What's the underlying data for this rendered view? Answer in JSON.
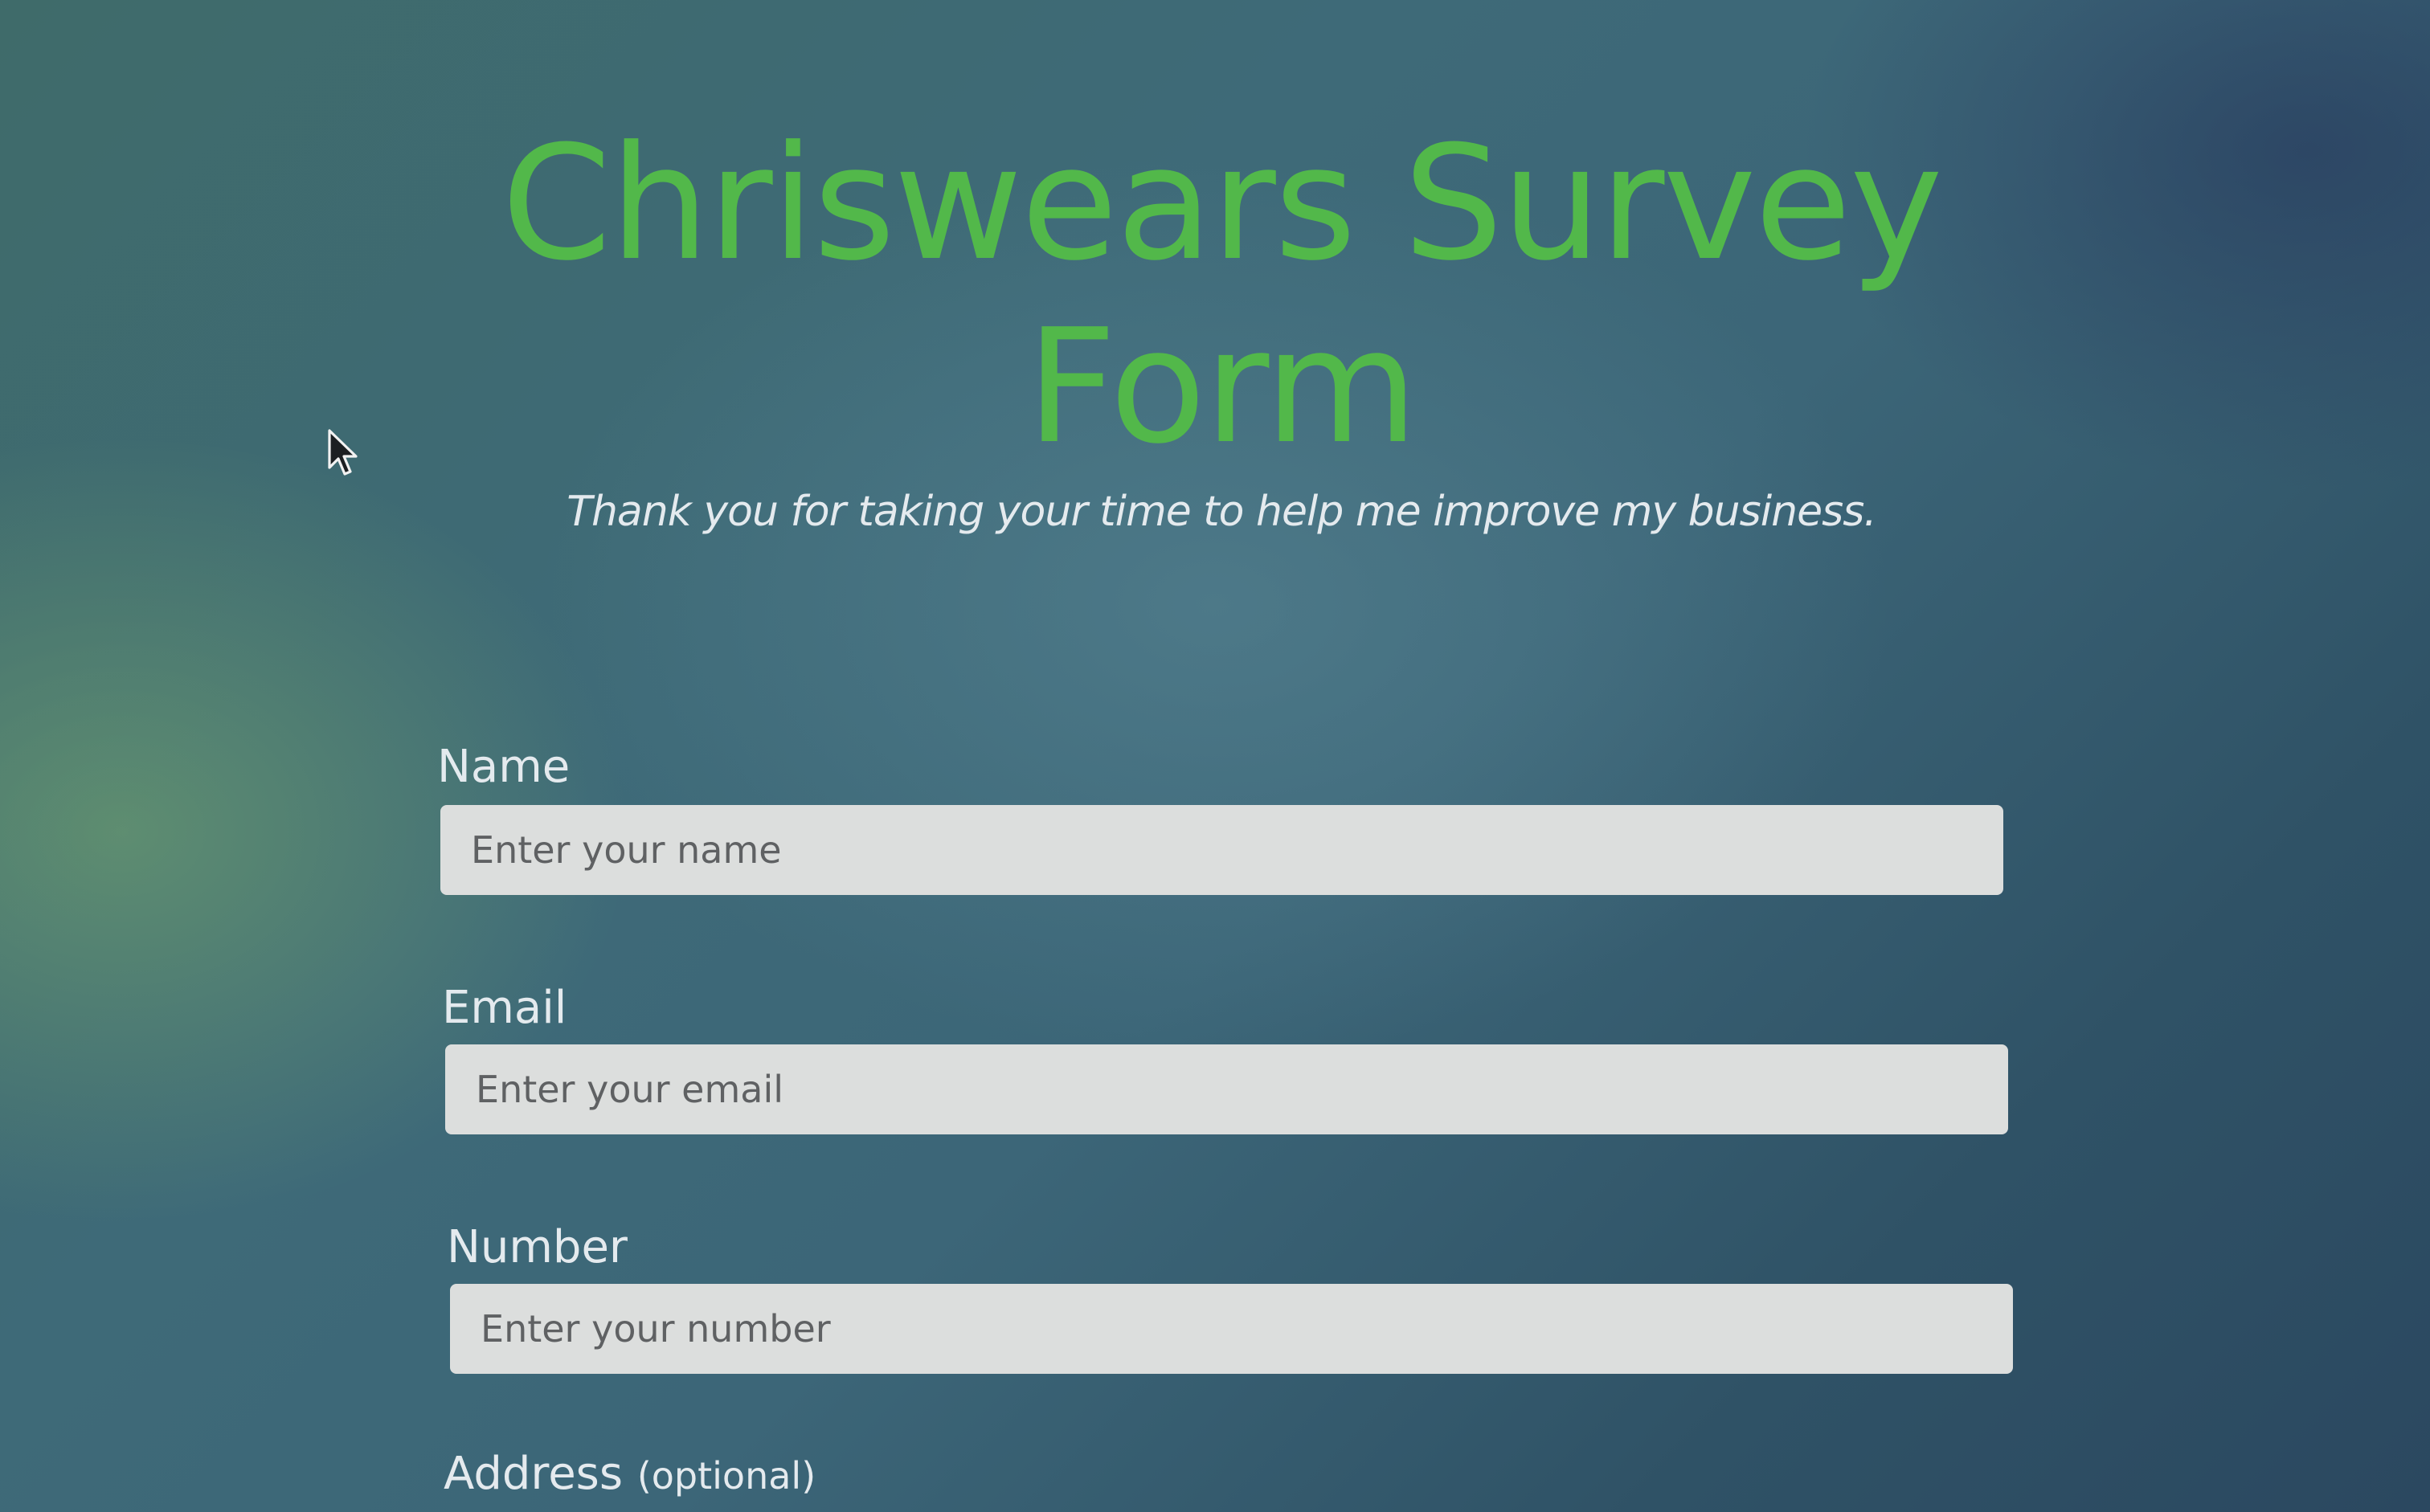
{
  "header": {
    "title": "Chriswears Survey Form",
    "description": "Thank you for taking your time to help me improve my business."
  },
  "form": {
    "name": {
      "label": "Name",
      "placeholder": "Enter your name"
    },
    "email": {
      "label": "Email",
      "placeholder": "Enter your email"
    },
    "number": {
      "label": "Number",
      "placeholder": "Enter your number"
    },
    "address": {
      "label": "Address",
      "hint": "(optional)"
    }
  },
  "theme": {
    "title_color": "#52b84a",
    "input_background": "#dcdedd",
    "label_color": "#e4eaee"
  },
  "icons": {
    "cursor": "mouse-pointer-icon"
  }
}
